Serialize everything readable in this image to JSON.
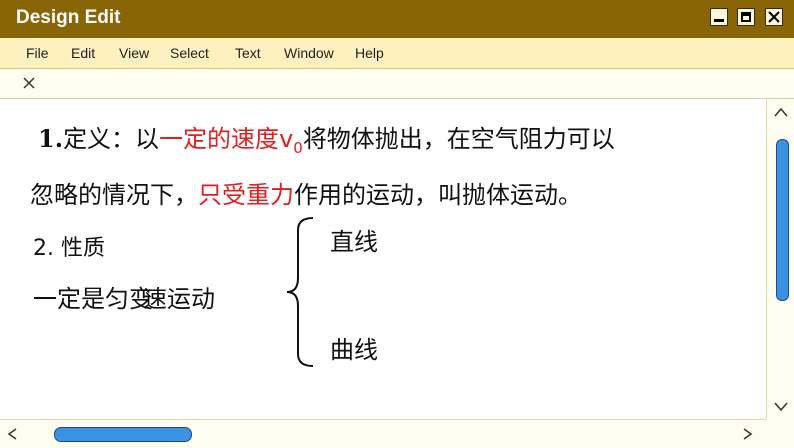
{
  "window": {
    "title": "Design Edit"
  },
  "menu": [
    "File",
    "Edit",
    "View",
    "Select",
    "Text",
    "Window",
    "Help"
  ],
  "slide": {
    "line1": {
      "num": "1.",
      "a": "定义：以",
      "b": "一定的速度",
      "c": "v",
      "sub": "0",
      "d": "将物体抛出，在空气阻力可以"
    },
    "line2": {
      "a": "忽略的情况下，",
      "b": "只受重力",
      "c": "作用的运动，叫抛体运动。"
    },
    "line3": "2. 性质",
    "line4": {
      "a": "一定是匀",
      "b": "变",
      "c": "速运动"
    },
    "branch1": "直线",
    "branch2": "曲线"
  }
}
